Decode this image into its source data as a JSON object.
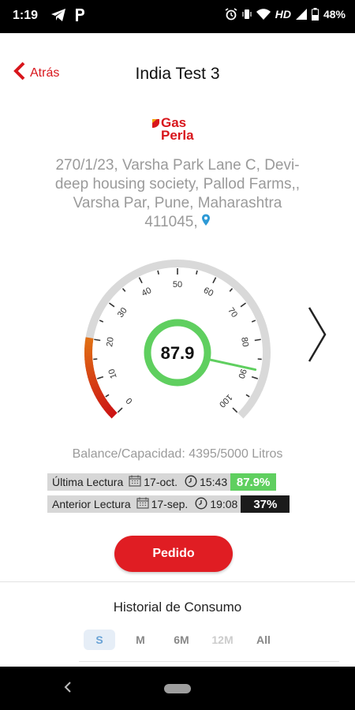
{
  "status_bar": {
    "time": "1:19",
    "battery": "48%",
    "network": "HD",
    "icons": [
      "telegram-icon",
      "parking-icon",
      "alarm-icon",
      "vibrate-icon",
      "wifi-icon",
      "signal-icon",
      "battery-icon"
    ]
  },
  "header": {
    "back_label": "Atrás",
    "title": "India Test 3"
  },
  "brand": {
    "line1": "Gas",
    "line2": "Perla",
    "color": "#d8161c"
  },
  "address": {
    "line1": "270/1/23, Varsha Park Lane C, Devi-",
    "line2": "deep housing society, Pallod Farms,,",
    "line3": "Varsha Par, Pune, Maharashtra",
    "line4": "411045,"
  },
  "gauge": {
    "value": "87.9",
    "level": 87.9,
    "min": 0,
    "max": 100,
    "ticks": [
      "0",
      "10",
      "20",
      "30",
      "40",
      "50",
      "60",
      "70",
      "80",
      "90",
      "100"
    ],
    "accent": "#5fcf5f"
  },
  "balance": {
    "text": "Balance/Capacidad: 4395/5000 Litros"
  },
  "readings": [
    {
      "label": "Última Lectura",
      "date": "17-oct.",
      "time": "15:43",
      "value": "87.9%"
    },
    {
      "label": "Anterior Lectura",
      "date": "17-sep.",
      "time": "19:08",
      "value": "37%"
    }
  ],
  "order_button": {
    "label": "Pedido",
    "color": "#e01d23"
  },
  "history": {
    "title": "Historial de Consumo",
    "tabs": [
      "S",
      "M",
      "6M",
      "12M",
      "All"
    ],
    "selected": "S"
  }
}
